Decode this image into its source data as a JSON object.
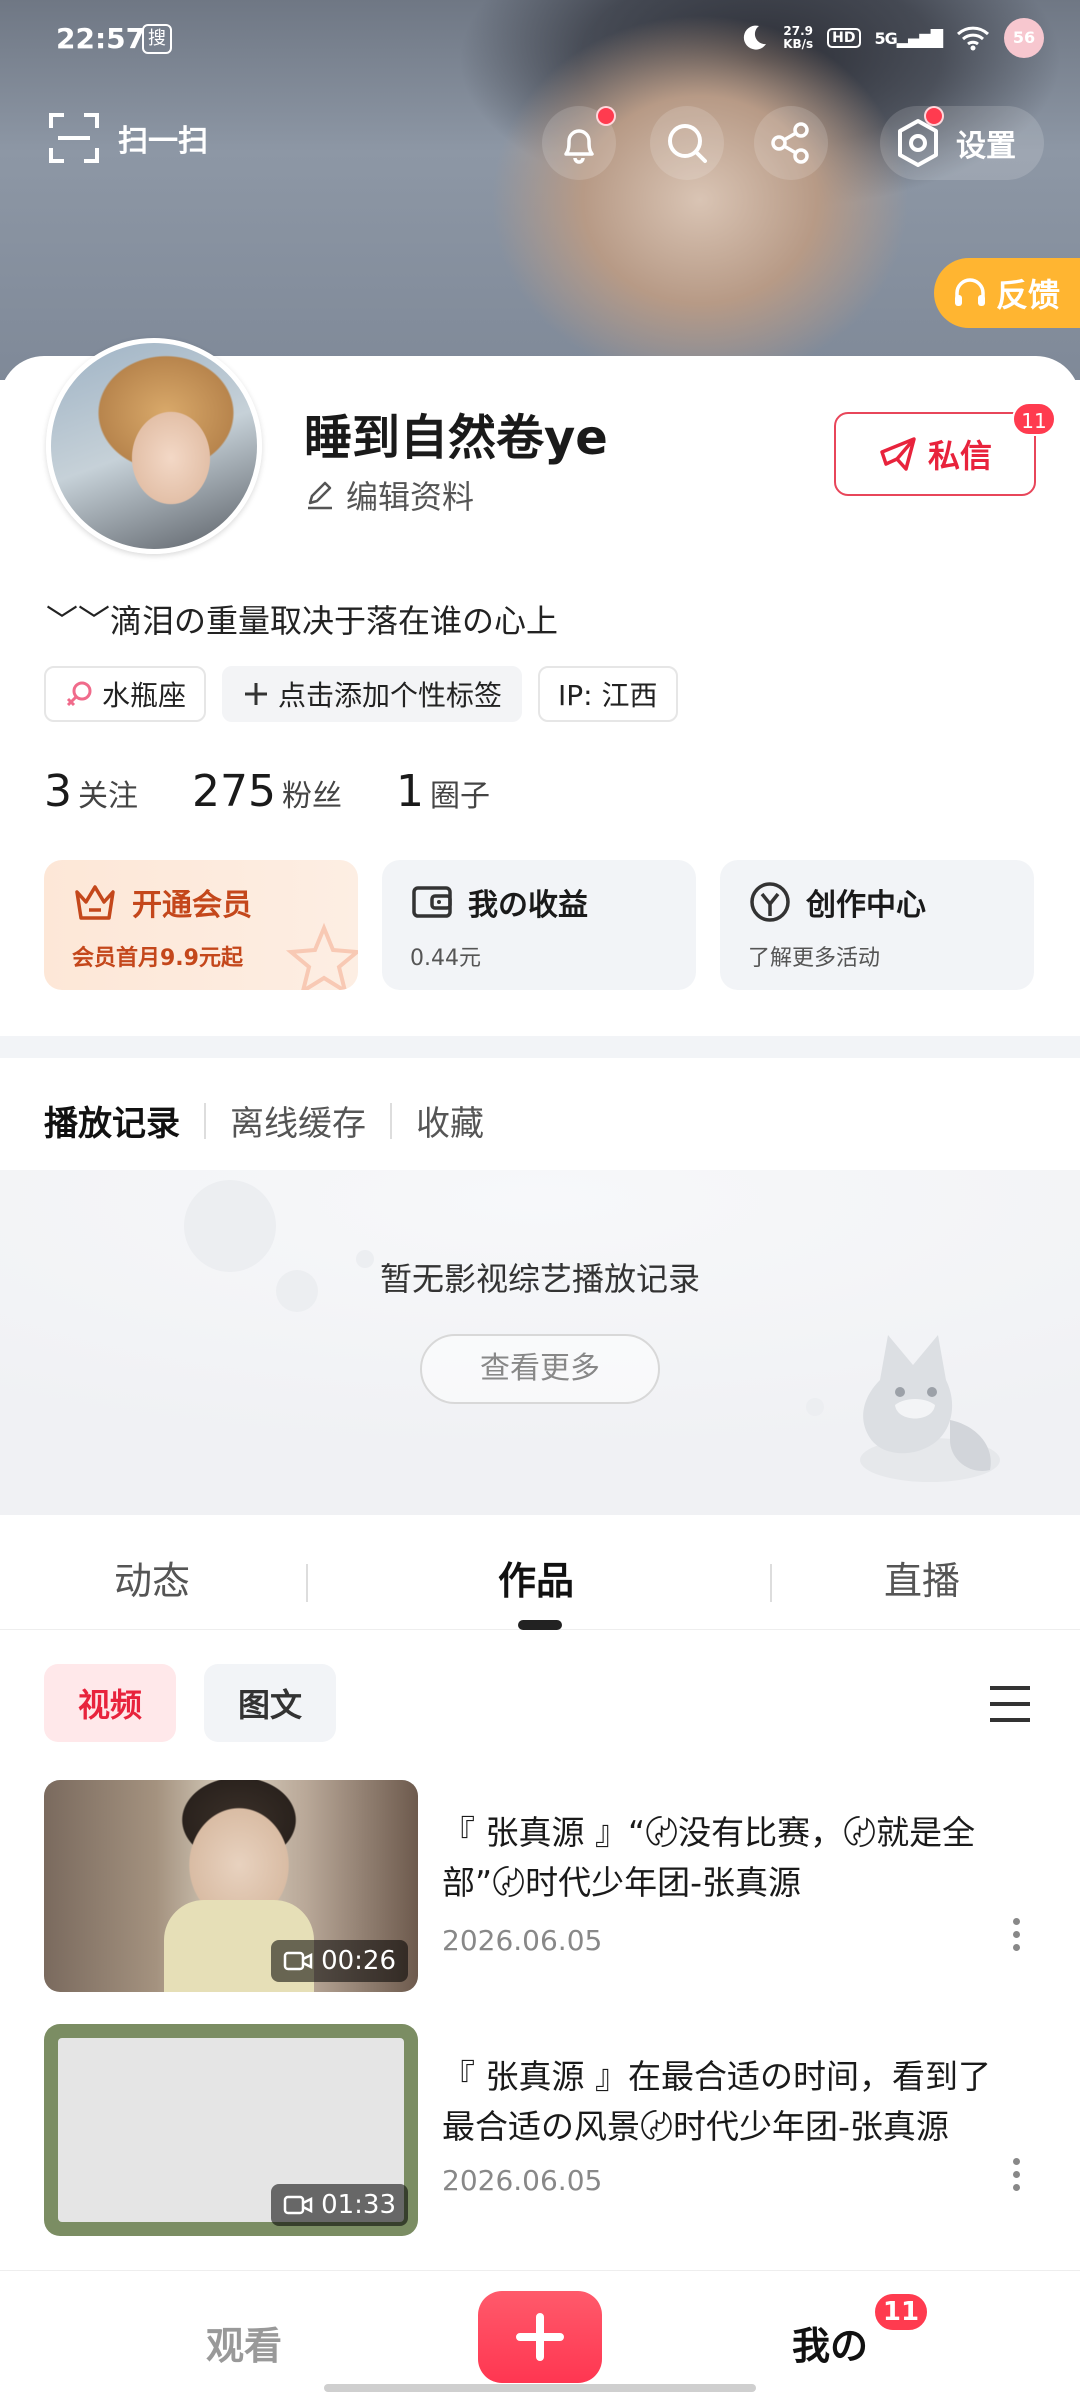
{
  "status_bar": {
    "time": "22:57",
    "app_glyph": "搜",
    "net_speed_value": "27.9",
    "net_speed_unit": "KB/s",
    "hd": "HD",
    "network": "5G",
    "battery": "56"
  },
  "header": {
    "scan_label": "扫一扫",
    "settings_label": "设置",
    "feedback_label": "反馈",
    "icons": [
      "scan-icon",
      "bell-icon",
      "search-icon",
      "share-icon",
      "settings-hex-icon",
      "headset-icon"
    ]
  },
  "profile": {
    "nickname": "睡到自然卷ye",
    "edit_label": "编辑资料",
    "message_label": "私信",
    "message_badge": "11",
    "bio": "﹀﹀滴泪の重量取决于落在谁の心上",
    "tags": {
      "zodiac": "水瓶座",
      "add_tag": "点击添加个性标签",
      "ip": "IP: 江西"
    },
    "stats": [
      {
        "num": "3",
        "label": "关注"
      },
      {
        "num": "275",
        "label": "粉丝"
      },
      {
        "num": "1",
        "label": "圈子"
      }
    ]
  },
  "quick_actions": {
    "vip": {
      "title": "开通会员",
      "sub": "会员首月9.9元起"
    },
    "earnings": {
      "title": "我の收益",
      "sub": "0.44元"
    },
    "creator": {
      "title": "创作中心",
      "sub": "了解更多活动"
    }
  },
  "history": {
    "tabs": [
      "播放记录",
      "离线缓存",
      "收藏"
    ],
    "empty_text": "暂无影视综艺播放记录",
    "more_label": "查看更多"
  },
  "content_tabs": [
    "动态",
    "作品",
    "直播"
  ],
  "filters": [
    "视频",
    "图文"
  ],
  "videos": [
    {
      "title": "『 张真源 』“〄没有比赛，〄就是全部”〄时代少年团-张真源",
      "date": "2026.06.05",
      "duration": "00:26"
    },
    {
      "title": "『 张真源 』在最合适の时间，看到了最合适の风景〄时代少年团-张真源",
      "date": "2026.06.05",
      "duration": "01:33"
    }
  ],
  "bottom_nav": {
    "watch": "观看",
    "me": "我の",
    "me_badge": "11"
  },
  "colors": {
    "accent_red": "#e8233c",
    "badge_red": "#ff3b4f",
    "feedback_orange": "#ffb531",
    "vip_brown": "#c4471b"
  }
}
